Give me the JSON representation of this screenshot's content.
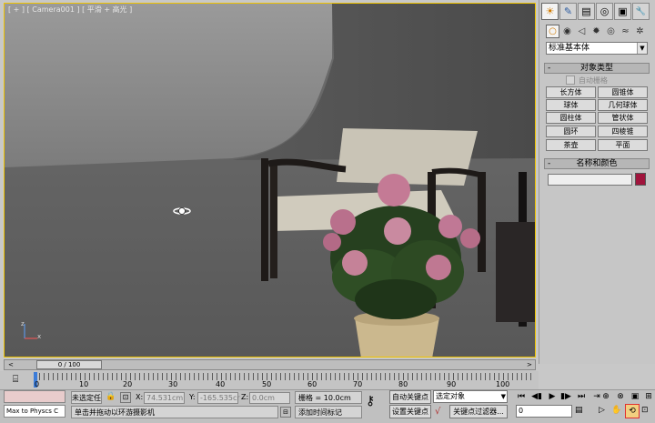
{
  "viewport": {
    "label": "[ + ] [ Camera001 ] [ 平滑 + 高光 ]",
    "axis_labels": {
      "z": "z",
      "x": "x"
    }
  },
  "command_panel": {
    "tabs": [
      {
        "name": "create",
        "icon": "☀"
      },
      {
        "name": "modify",
        "icon": "✎"
      },
      {
        "name": "hierarchy",
        "icon": "▤"
      },
      {
        "name": "motion",
        "icon": "◎"
      },
      {
        "name": "display",
        "icon": "▣"
      },
      {
        "name": "utilities",
        "icon": "🔧"
      }
    ],
    "categories": [
      "○",
      "◉",
      "◁",
      "✹",
      "◎",
      "≈",
      "✲"
    ],
    "dropdown_value": "标准基本体",
    "object_type": {
      "title": "对象类型",
      "autogrid_label": "自动栅格",
      "buttons": [
        "长方体",
        "圆锥体",
        "球体",
        "几何球体",
        "圆柱体",
        "管状体",
        "圆环",
        "四棱锥",
        "茶壶",
        "平面"
      ]
    },
    "name_color": {
      "title": "名称和颜色",
      "swatch_color": "#a0143c"
    }
  },
  "timeline": {
    "frame_counter": "0 / 100",
    "ticks": [
      "0",
      "10",
      "20",
      "30",
      "40",
      "50",
      "60",
      "70",
      "80",
      "90",
      "100"
    ]
  },
  "status": {
    "maxscript": "Max to Physcs C",
    "selection": "未选定任",
    "prompt": "单击并拖动以环游摄影机",
    "x_label": "X:",
    "x_value": "74.531cm",
    "y_label": "Y:",
    "y_value": "-165.535cr",
    "z_label": "Z:",
    "z_value": "0.0cm",
    "grid": "栅格 = 10.0cm",
    "add_time_tag": "添加时间标记",
    "auto_key": "自动关键点",
    "set_key": "设置关键点",
    "selected_object": "选定对象",
    "key_filters": "关键点过滤器...",
    "current_frame": "0"
  }
}
